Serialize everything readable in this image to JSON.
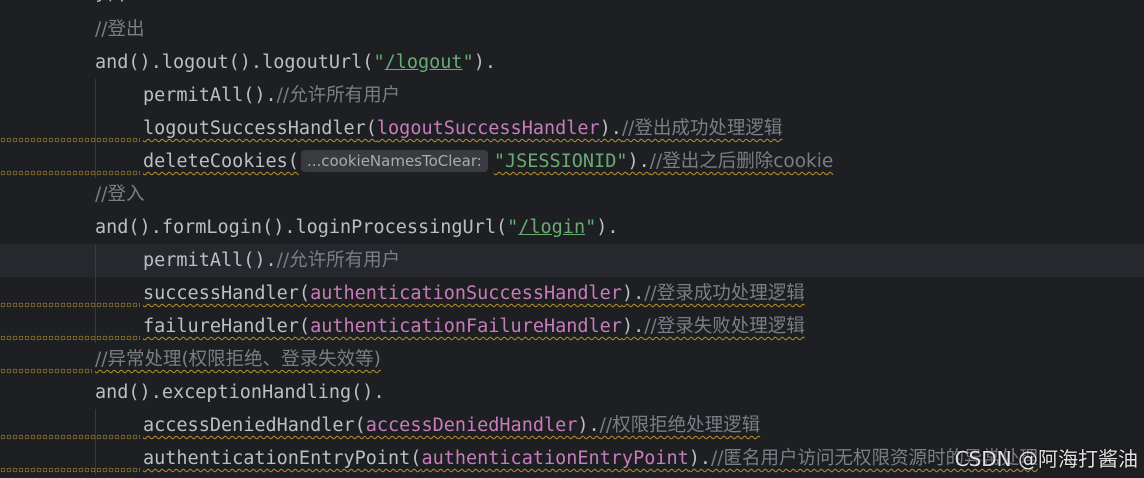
{
  "editor": {
    "top_fragment": "});",
    "lines": [
      {
        "type": "comment",
        "indent": 1,
        "text": "//登出"
      },
      {
        "type": "call",
        "indent": 1,
        "parts": [
          {
            "k": "fn",
            "t": "and().logout().logoutUrl("
          },
          {
            "k": "str",
            "t": "\"/logout\""
          },
          {
            "k": "fn",
            "t": ")."
          }
        ]
      },
      {
        "type": "call",
        "indent": 2,
        "parts": [
          {
            "k": "fn",
            "t": "permitAll()."
          },
          {
            "k": "cm",
            "t": "//允许所有用户"
          }
        ]
      },
      {
        "type": "call",
        "indent": 2,
        "warn": true,
        "parts": [
          {
            "k": "fn",
            "t": "logoutSuccessHandler("
          },
          {
            "k": "fld",
            "t": "logoutSuccessHandler"
          },
          {
            "k": "fn",
            "t": ")."
          },
          {
            "k": "cm",
            "t": "//登出成功处理逻辑"
          }
        ]
      },
      {
        "type": "call",
        "indent": 2,
        "warn": true,
        "parts": [
          {
            "k": "fn",
            "t": "deleteCookies("
          },
          {
            "k": "hint",
            "t": "...cookieNamesToClear:"
          },
          {
            "k": "str",
            "t": "\"JSESSIONID\""
          },
          {
            "k": "fn",
            "t": ")."
          },
          {
            "k": "cm",
            "t": "//登出之后删除cookie"
          }
        ]
      },
      {
        "type": "comment",
        "indent": 1,
        "text": "//登入"
      },
      {
        "type": "call",
        "indent": 1,
        "parts": [
          {
            "k": "fn",
            "t": "and().formLogin().loginProcessingUrl("
          },
          {
            "k": "str",
            "t": "\"/login\""
          },
          {
            "k": "fn",
            "t": ")."
          }
        ]
      },
      {
        "type": "call",
        "indent": 2,
        "current": true,
        "parts": [
          {
            "k": "fn",
            "t": "permitAll()."
          },
          {
            "k": "cm",
            "t": "//允许所有用户"
          }
        ]
      },
      {
        "type": "call",
        "indent": 2,
        "warn": true,
        "parts": [
          {
            "k": "fn",
            "t": "successHandler("
          },
          {
            "k": "fld",
            "t": "authenticationSuccessHandler"
          },
          {
            "k": "fn",
            "t": ")."
          },
          {
            "k": "cm",
            "t": "//登录成功处理逻辑"
          }
        ]
      },
      {
        "type": "call",
        "indent": 2,
        "warn": true,
        "parts": [
          {
            "k": "fn",
            "t": "failureHandler("
          },
          {
            "k": "fld",
            "t": "authenticationFailureHandler"
          },
          {
            "k": "fn",
            "t": ")."
          },
          {
            "k": "cm",
            "t": "//登录失败处理逻辑"
          }
        ]
      },
      {
        "type": "comment",
        "indent": 1,
        "warn": true,
        "text": "//异常处理(权限拒绝、登录失效等)"
      },
      {
        "type": "call",
        "indent": 1,
        "parts": [
          {
            "k": "fn",
            "t": "and().exceptionHandling()."
          }
        ]
      },
      {
        "type": "call",
        "indent": 2,
        "warn": true,
        "parts": [
          {
            "k": "fn",
            "t": "accessDeniedHandler("
          },
          {
            "k": "fld",
            "t": "accessDeniedHandler"
          },
          {
            "k": "fn",
            "t": ")."
          },
          {
            "k": "cm",
            "t": "//权限拒绝处理逻辑"
          }
        ]
      },
      {
        "type": "call",
        "indent": 2,
        "warn": true,
        "parts": [
          {
            "k": "fn",
            "t": "authenticationEntryPoint("
          },
          {
            "k": "fld",
            "t": "authenticationEntryPoint"
          },
          {
            "k": "fn",
            "t": ")."
          },
          {
            "k": "cm",
            "t": "//匿名用户访问无权限资源时的异常处理"
          }
        ]
      }
    ]
  },
  "watermark": "CSDN @阿海打酱油",
  "colors": {
    "background": "#1e1f22",
    "text": "#bcbec4",
    "comment": "#7a7e85",
    "string": "#6aab73",
    "field": "#c77dbb",
    "warning": "#b9942a",
    "current_line": "#26282e"
  }
}
